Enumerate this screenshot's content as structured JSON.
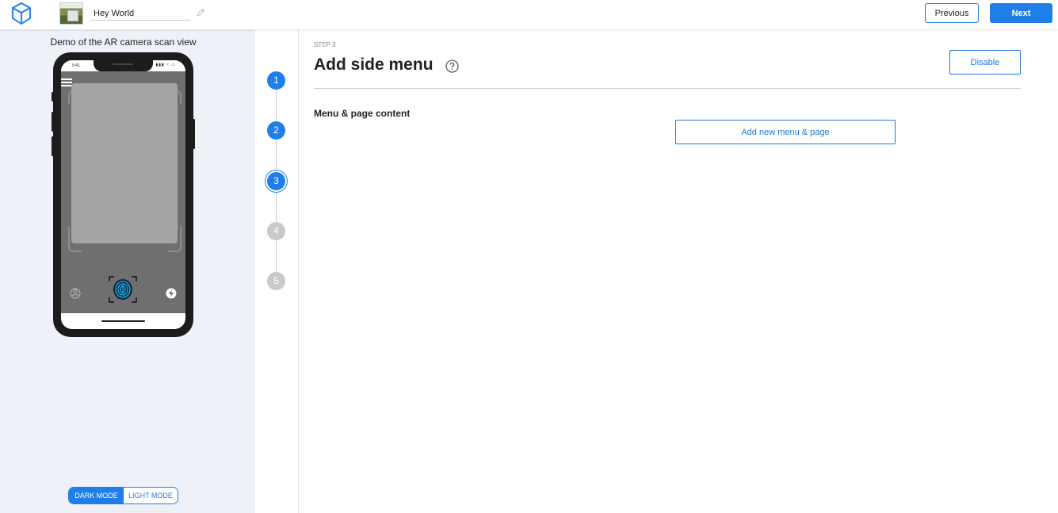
{
  "topbar": {
    "project_name": "Hey World",
    "previous_label": "Previous",
    "next_label": "Next",
    "logo_icon": "cube-logo-icon",
    "edit_icon": "pencil-icon"
  },
  "preview": {
    "caption": "Demo of the AR camera scan view",
    "status_time": "9:41",
    "status_icons": "▮▮▮ ≈ ▭",
    "mode_dark_label": "DARK MODE",
    "mode_light_label": "LIGHT MODE",
    "selected_mode": "dark"
  },
  "stepper": {
    "steps": [
      {
        "label": "1",
        "state": "done"
      },
      {
        "label": "2",
        "state": "done"
      },
      {
        "label": "3",
        "state": "current"
      },
      {
        "label": "4",
        "state": "todo"
      },
      {
        "label": "5",
        "state": "todo"
      }
    ]
  },
  "main": {
    "step_label": "STEP 3",
    "title": "Add side menu",
    "disable_label": "Disable",
    "section_label": "Menu & page content",
    "add_button_label": "Add new menu & page"
  },
  "colors": {
    "accent": "#1f7ee8",
    "panel_bg": "#eef2f8",
    "step_inactive": "#c9c9c9"
  }
}
